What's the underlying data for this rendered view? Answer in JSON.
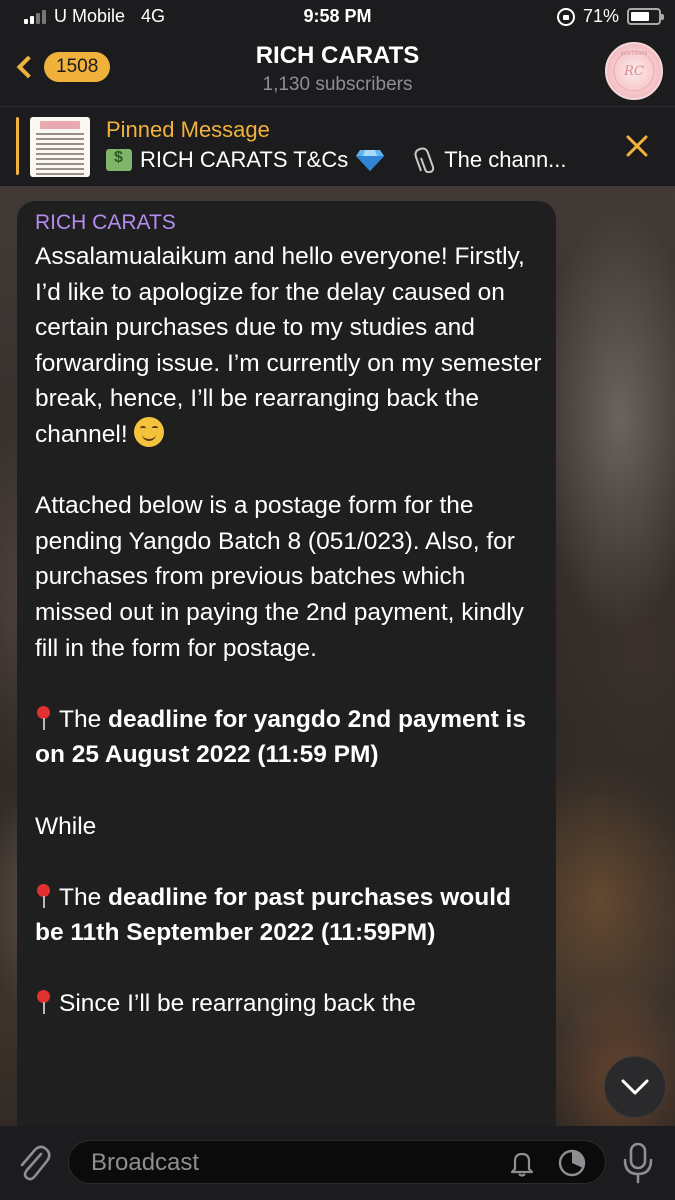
{
  "status_bar": {
    "carrier": "U Mobile",
    "network": "4G",
    "time": "9:58 PM",
    "battery": "71%",
    "battery_level": 0.71
  },
  "header": {
    "back_badge": "1508",
    "title": "RICH CARATS",
    "subtitle": "1,130 subscribers"
  },
  "pinned": {
    "label": "Pinned Message",
    "preview_title": "RICH CARATS T&Cs",
    "preview_text": "The chann..."
  },
  "message": {
    "sender": "RICH CARATS",
    "p1": "Assalamualaikum and hello everyone! Firstly, I’d like to apologize for the delay caused on certain purchases due to my studies and forwarding issue. I’m currently on my semester break, hence, I’ll be rearranging back the channel!",
    "p2": "Attached below is a postage form for the pending Yangdo Batch 8 (051/023). Also, for purchases from previous batches which missed out in paying the 2nd payment, kindly fill in the form for postage.",
    "p3_prefix": "The ",
    "p3_bold": "deadline for yangdo 2nd payment is on 25 August 2022 (11:59 PM)",
    "p4": "While",
    "p5_prefix": "The ",
    "p5_bold": "deadline for past purchases would be 11th September 2022 (11:59PM)",
    "p6": "Since I’ll be rearranging back the"
  },
  "bottom_bar": {
    "placeholder": "Broadcast"
  },
  "colors": {
    "accent": "#f0b23a",
    "sender": "#b48cf0",
    "bubble": "#1f1f20",
    "bar": "#1c1c1e"
  },
  "icons": [
    "signal-icon",
    "rotation-lock-icon",
    "battery-icon",
    "back-chevron-icon",
    "money-emoji-icon",
    "gem-emoji-icon",
    "paperclip-emoji-icon",
    "close-icon",
    "pushpin-emoji-icon",
    "smile-emoji-icon",
    "chevron-down-icon",
    "attach-icon",
    "bell-icon",
    "timer-icon",
    "mic-icon"
  ]
}
